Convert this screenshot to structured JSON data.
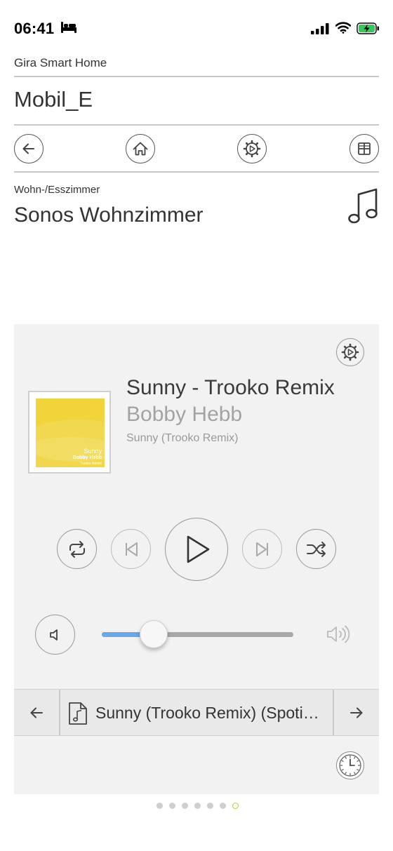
{
  "status_bar": {
    "time": "06:41"
  },
  "app": {
    "title": "Gira Smart Home"
  },
  "project": {
    "title": "Mobil_E"
  },
  "nav": [
    {
      "name": "back-button",
      "icon": "arrow-left-icon"
    },
    {
      "name": "home-button",
      "icon": "home-icon"
    },
    {
      "name": "settings-button",
      "icon": "gear-icon"
    },
    {
      "name": "grid-view-button",
      "icon": "grid-icon"
    }
  ],
  "location": {
    "room": "Wohn-/Esszimmer",
    "device": "Sonos Wohnzimmer"
  },
  "player": {
    "track_title": "Sunny - Trooko Remix",
    "artist": "Bobby Hebb",
    "album": "Sunny (Trooko Remix)",
    "cover": {
      "title": "Sunny",
      "artist": "Bobby Hebb",
      "subtitle": "Trooko Remix",
      "color": "#f1d33a"
    },
    "volume": 0.27,
    "volume_fill_color": "#6ba6e8"
  },
  "queue": {
    "current": "Sunny (Trooko Remix) (Spotify)"
  },
  "pagination": {
    "count": 7,
    "active_index": 6,
    "active_color": "#b5d233"
  }
}
